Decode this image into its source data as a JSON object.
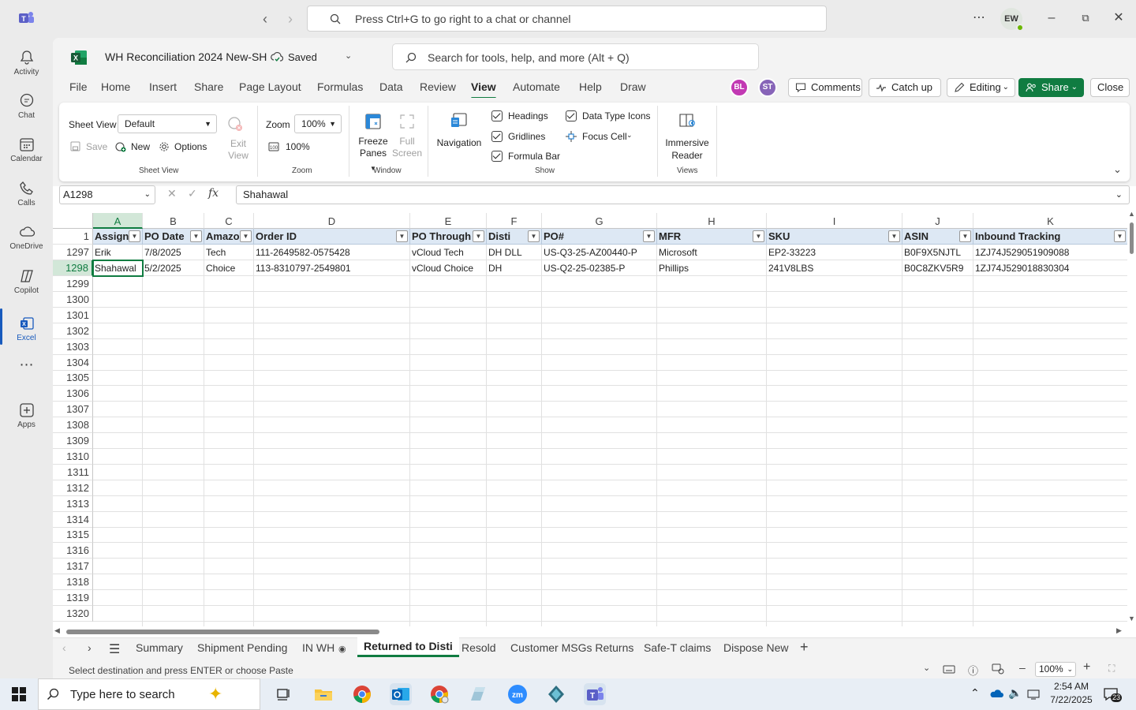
{
  "teams": {
    "search_placeholder": "Press Ctrl+G to go right to a chat or channel",
    "avatar_initials": "EW",
    "rail": [
      {
        "label": "Activity",
        "icon": "bell-icon"
      },
      {
        "label": "Chat",
        "icon": "chat-icon"
      },
      {
        "label": "Calendar",
        "icon": "calendar-icon"
      },
      {
        "label": "Calls",
        "icon": "phone-icon"
      },
      {
        "label": "OneDrive",
        "icon": "cloud-icon"
      },
      {
        "label": "Copilot",
        "icon": "copilot-icon"
      },
      {
        "label": "Excel",
        "icon": "excel-icon"
      },
      {
        "label": "",
        "icon": "more-icon"
      },
      {
        "label": "Apps",
        "icon": "add-apps-icon"
      }
    ]
  },
  "excel": {
    "doc_title": "WH Reconciliation 2024 New-SH",
    "saved_label": "Saved",
    "search_placeholder": "Search for tools, help, and more (Alt + Q)",
    "menus": [
      "File",
      "Home",
      "Insert",
      "Share",
      "Page Layout",
      "Formulas",
      "Data",
      "Review",
      "View",
      "Automate",
      "Help",
      "Draw"
    ],
    "active_menu": "View",
    "collab": [
      {
        "initials": "BL",
        "color": "#c239b3"
      },
      {
        "initials": "ST",
        "color": "#8764b8"
      }
    ],
    "comments_label": "Comments",
    "catchup_label": "Catch up",
    "editing_label": "Editing",
    "share_label": "Share",
    "close_label": "Close",
    "ribbon": {
      "sheet_view_label": "Sheet View",
      "sheet_view_value": "Default",
      "save_label": "Save",
      "new_label": "New",
      "options_label": "Options",
      "exit_view_label": "Exit View",
      "exit_line1": "Exit",
      "exit_line2": "View",
      "sheet_view_group": "Sheet View",
      "zoom_label": "Zoom",
      "zoom_value": "100%",
      "zoom100_label": "100%",
      "zoom_group": "Zoom",
      "freeze_line1": "Freeze",
      "freeze_line2": "Panes",
      "full_line1": "Full",
      "full_line2": "Screen",
      "window_group": "Window",
      "navigation_label": "Navigation",
      "headings_label": "Headings",
      "gridlines_label": "Gridlines",
      "formula_bar_label": "Formula Bar",
      "data_type_icons_label": "Data Type Icons",
      "focus_cell_label": "Focus Cell",
      "show_group": "Show",
      "immersive_line1": "Immersive",
      "immersive_line2": "Reader",
      "views_group": "Views"
    },
    "name_box": "A1298",
    "formula_value": "Shahawal",
    "columns": [
      {
        "letter": "A",
        "header": "Assigne"
      },
      {
        "letter": "B",
        "header": "PO Date"
      },
      {
        "letter": "C",
        "header": "Amazo"
      },
      {
        "letter": "D",
        "header": "Order ID"
      },
      {
        "letter": "E",
        "header": "PO Through"
      },
      {
        "letter": "F",
        "header": "Disti"
      },
      {
        "letter": "G",
        "header": "PO#"
      },
      {
        "letter": "H",
        "header": "MFR"
      },
      {
        "letter": "I",
        "header": "SKU"
      },
      {
        "letter": "J",
        "header": "ASIN"
      },
      {
        "letter": "K",
        "header": "Inbound Tracking"
      }
    ],
    "header_row_number": "1",
    "rows": [
      {
        "num": "1297",
        "cells": [
          "Erik",
          "7/8/2025",
          "Tech",
          "111-2649582-0575428",
          "vCloud Tech",
          "DH DLL",
          "US-Q3-25-AZ00440-P",
          "Microsoft",
          "EP2-33223",
          "B0F9X5NJTL",
          "1ZJ74J529051909088"
        ]
      },
      {
        "num": "1298",
        "cells": [
          "Shahawal",
          "5/2/2025",
          "Choice",
          "113-8310797-2549801",
          "vCloud Choice",
          "DH",
          "US-Q2-25-02385-P",
          "Phillips",
          "241V8LBS",
          "B0C8ZKV5R9",
          "1ZJ74J529018830304"
        ]
      }
    ],
    "empty_rows": [
      "1299",
      "1300",
      "1301",
      "1302",
      "1303",
      "1304",
      "1305",
      "1306",
      "1307",
      "1308",
      "1309",
      "1310",
      "1311",
      "1312",
      "1313",
      "1314",
      "1315",
      "1316",
      "1317",
      "1318",
      "1319",
      "1320"
    ],
    "sheet_tabs": [
      "Summary",
      "Shipment Pending",
      "IN WH",
      "Returned to Disti",
      "Resold",
      "Customer MSGs Returns",
      "Safe-T claims",
      "Dispose New"
    ],
    "active_tab": "Returned to Disti",
    "status_message": "Select destination and press ENTER or choose Paste",
    "status_zoom": "100%"
  },
  "taskbar": {
    "search_placeholder": "Type here to search",
    "time": "2:54 AM",
    "date": "7/22/2025",
    "notification_count": "23"
  },
  "colors": {
    "excel_green": "#107c41",
    "teams_purple": "#5b5fc7",
    "header_fill": "#dde8f4"
  }
}
